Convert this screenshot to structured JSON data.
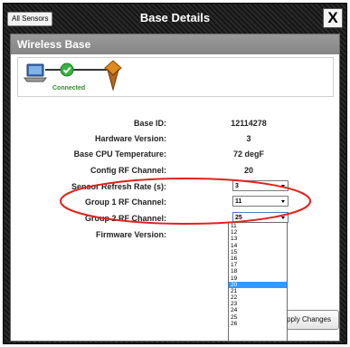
{
  "window": {
    "back_label": "All Sensors",
    "title": "Base Details",
    "close_label": "X"
  },
  "section": {
    "title": "Wireless Base"
  },
  "status": {
    "label": "Connected",
    "color": "#2e8b2e"
  },
  "details": {
    "base_id": {
      "label": "Base ID:",
      "value": "12114278"
    },
    "hardware_version": {
      "label": "Hardware Version:",
      "value": "3"
    },
    "cpu_temp": {
      "label": "Base CPU Temperature:",
      "value": "72 degF"
    },
    "config_rf": {
      "label": "Config RF Channel:",
      "value": "20"
    },
    "refresh_rate": {
      "label": "Sensor Refresh Rate (s):",
      "value": "3"
    },
    "group1_rf": {
      "label": "Group 1 RF Channel:",
      "value": "11"
    },
    "group2_rf": {
      "label": "Group 2 RF Channel:",
      "value": "25"
    },
    "firmware": {
      "label": "Firmware Version:",
      "value": ""
    }
  },
  "dropdown": {
    "options": [
      "11",
      "12",
      "13",
      "14",
      "15",
      "16",
      "17",
      "18",
      "19",
      "20",
      "21",
      "22",
      "23",
      "24",
      "25",
      "26"
    ],
    "highlighted": "20"
  },
  "apply_label": "Apply Changes",
  "colors": {
    "highlight": "#3399ff",
    "annotation": "#e0221c",
    "header": "#8f8f8f"
  },
  "icons": [
    "laptop-icon",
    "check-icon",
    "base-station-icon",
    "close-icon",
    "dropdown-arrow-icon"
  ]
}
